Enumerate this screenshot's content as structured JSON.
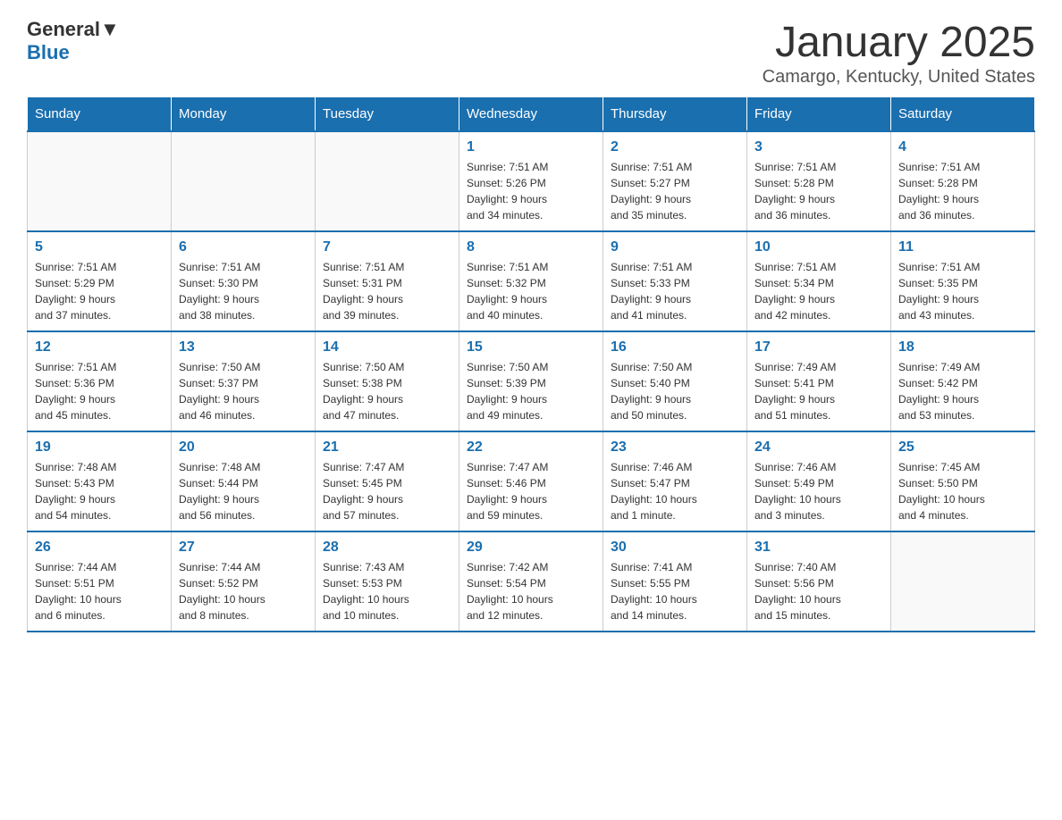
{
  "logo": {
    "general": "General",
    "blue": "Blue"
  },
  "title": "January 2025",
  "subtitle": "Camargo, Kentucky, United States",
  "days_of_week": [
    "Sunday",
    "Monday",
    "Tuesday",
    "Wednesday",
    "Thursday",
    "Friday",
    "Saturday"
  ],
  "weeks": [
    [
      {
        "day": "",
        "info": ""
      },
      {
        "day": "",
        "info": ""
      },
      {
        "day": "",
        "info": ""
      },
      {
        "day": "1",
        "info": "Sunrise: 7:51 AM\nSunset: 5:26 PM\nDaylight: 9 hours\nand 34 minutes."
      },
      {
        "day": "2",
        "info": "Sunrise: 7:51 AM\nSunset: 5:27 PM\nDaylight: 9 hours\nand 35 minutes."
      },
      {
        "day": "3",
        "info": "Sunrise: 7:51 AM\nSunset: 5:28 PM\nDaylight: 9 hours\nand 36 minutes."
      },
      {
        "day": "4",
        "info": "Sunrise: 7:51 AM\nSunset: 5:28 PM\nDaylight: 9 hours\nand 36 minutes."
      }
    ],
    [
      {
        "day": "5",
        "info": "Sunrise: 7:51 AM\nSunset: 5:29 PM\nDaylight: 9 hours\nand 37 minutes."
      },
      {
        "day": "6",
        "info": "Sunrise: 7:51 AM\nSunset: 5:30 PM\nDaylight: 9 hours\nand 38 minutes."
      },
      {
        "day": "7",
        "info": "Sunrise: 7:51 AM\nSunset: 5:31 PM\nDaylight: 9 hours\nand 39 minutes."
      },
      {
        "day": "8",
        "info": "Sunrise: 7:51 AM\nSunset: 5:32 PM\nDaylight: 9 hours\nand 40 minutes."
      },
      {
        "day": "9",
        "info": "Sunrise: 7:51 AM\nSunset: 5:33 PM\nDaylight: 9 hours\nand 41 minutes."
      },
      {
        "day": "10",
        "info": "Sunrise: 7:51 AM\nSunset: 5:34 PM\nDaylight: 9 hours\nand 42 minutes."
      },
      {
        "day": "11",
        "info": "Sunrise: 7:51 AM\nSunset: 5:35 PM\nDaylight: 9 hours\nand 43 minutes."
      }
    ],
    [
      {
        "day": "12",
        "info": "Sunrise: 7:51 AM\nSunset: 5:36 PM\nDaylight: 9 hours\nand 45 minutes."
      },
      {
        "day": "13",
        "info": "Sunrise: 7:50 AM\nSunset: 5:37 PM\nDaylight: 9 hours\nand 46 minutes."
      },
      {
        "day": "14",
        "info": "Sunrise: 7:50 AM\nSunset: 5:38 PM\nDaylight: 9 hours\nand 47 minutes."
      },
      {
        "day": "15",
        "info": "Sunrise: 7:50 AM\nSunset: 5:39 PM\nDaylight: 9 hours\nand 49 minutes."
      },
      {
        "day": "16",
        "info": "Sunrise: 7:50 AM\nSunset: 5:40 PM\nDaylight: 9 hours\nand 50 minutes."
      },
      {
        "day": "17",
        "info": "Sunrise: 7:49 AM\nSunset: 5:41 PM\nDaylight: 9 hours\nand 51 minutes."
      },
      {
        "day": "18",
        "info": "Sunrise: 7:49 AM\nSunset: 5:42 PM\nDaylight: 9 hours\nand 53 minutes."
      }
    ],
    [
      {
        "day": "19",
        "info": "Sunrise: 7:48 AM\nSunset: 5:43 PM\nDaylight: 9 hours\nand 54 minutes."
      },
      {
        "day": "20",
        "info": "Sunrise: 7:48 AM\nSunset: 5:44 PM\nDaylight: 9 hours\nand 56 minutes."
      },
      {
        "day": "21",
        "info": "Sunrise: 7:47 AM\nSunset: 5:45 PM\nDaylight: 9 hours\nand 57 minutes."
      },
      {
        "day": "22",
        "info": "Sunrise: 7:47 AM\nSunset: 5:46 PM\nDaylight: 9 hours\nand 59 minutes."
      },
      {
        "day": "23",
        "info": "Sunrise: 7:46 AM\nSunset: 5:47 PM\nDaylight: 10 hours\nand 1 minute."
      },
      {
        "day": "24",
        "info": "Sunrise: 7:46 AM\nSunset: 5:49 PM\nDaylight: 10 hours\nand 3 minutes."
      },
      {
        "day": "25",
        "info": "Sunrise: 7:45 AM\nSunset: 5:50 PM\nDaylight: 10 hours\nand 4 minutes."
      }
    ],
    [
      {
        "day": "26",
        "info": "Sunrise: 7:44 AM\nSunset: 5:51 PM\nDaylight: 10 hours\nand 6 minutes."
      },
      {
        "day": "27",
        "info": "Sunrise: 7:44 AM\nSunset: 5:52 PM\nDaylight: 10 hours\nand 8 minutes."
      },
      {
        "day": "28",
        "info": "Sunrise: 7:43 AM\nSunset: 5:53 PM\nDaylight: 10 hours\nand 10 minutes."
      },
      {
        "day": "29",
        "info": "Sunrise: 7:42 AM\nSunset: 5:54 PM\nDaylight: 10 hours\nand 12 minutes."
      },
      {
        "day": "30",
        "info": "Sunrise: 7:41 AM\nSunset: 5:55 PM\nDaylight: 10 hours\nand 14 minutes."
      },
      {
        "day": "31",
        "info": "Sunrise: 7:40 AM\nSunset: 5:56 PM\nDaylight: 10 hours\nand 15 minutes."
      },
      {
        "day": "",
        "info": ""
      }
    ]
  ]
}
